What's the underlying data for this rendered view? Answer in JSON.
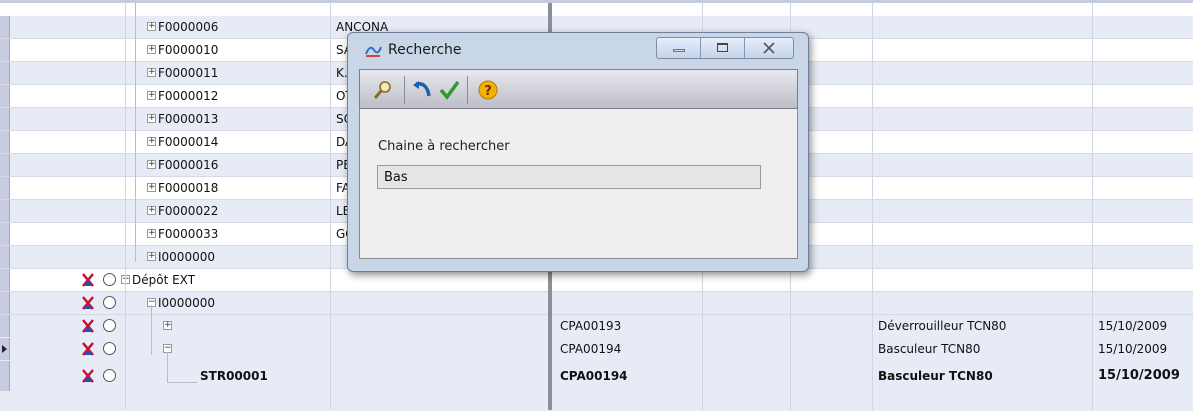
{
  "tree_rows": [
    {
      "id": "F0000006",
      "name": "ANCONA"
    },
    {
      "id": "F0000010",
      "name": "SA"
    },
    {
      "id": "F0000011",
      "name": "K.A"
    },
    {
      "id": "F0000012",
      "name": "OT"
    },
    {
      "id": "F0000013",
      "name": "SC"
    },
    {
      "id": "F0000014",
      "name": "DA"
    },
    {
      "id": "F0000016",
      "name": "PE"
    },
    {
      "id": "F0000018",
      "name": "FA"
    },
    {
      "id": "F0000022",
      "name": "LEI"
    },
    {
      "id": "F0000033",
      "name": "GO"
    },
    {
      "id": "I0000000",
      "name": ""
    }
  ],
  "depot_label": "Dépôt EXT",
  "depot_child": "I0000000",
  "lower_rows": [
    {
      "code": "CPA00193",
      "desc": "Déverrouilleur TCN80",
      "date": "15/10/2009"
    },
    {
      "code": "CPA00194",
      "desc": "Basculeur TCN80",
      "date": "15/10/2009"
    },
    {
      "code": "CPA00194",
      "desc": "Basculeur TCN80",
      "date": "15/10/2009",
      "str": "STR00001"
    }
  ],
  "dialog": {
    "title": "Recherche",
    "label": "Chaine à rechercher",
    "value": "Bas"
  },
  "icons": {
    "toolbar": [
      "search-icon",
      "undo-icon",
      "check-icon",
      "help-icon"
    ],
    "window": [
      "minimize-icon",
      "maximize-icon",
      "close-icon"
    ]
  }
}
